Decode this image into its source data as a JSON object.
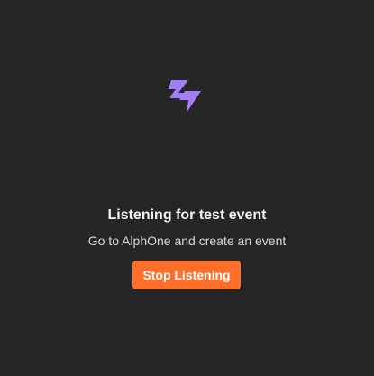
{
  "listening": {
    "logo_icon": "lightning-bolt-icon",
    "accent_color": "#a47dfb",
    "title": "Listening for test event",
    "subtitle": "Go to AlphOne and create an event",
    "stop_button_label": "Stop Listening",
    "button_color": "#ff6f2c"
  }
}
